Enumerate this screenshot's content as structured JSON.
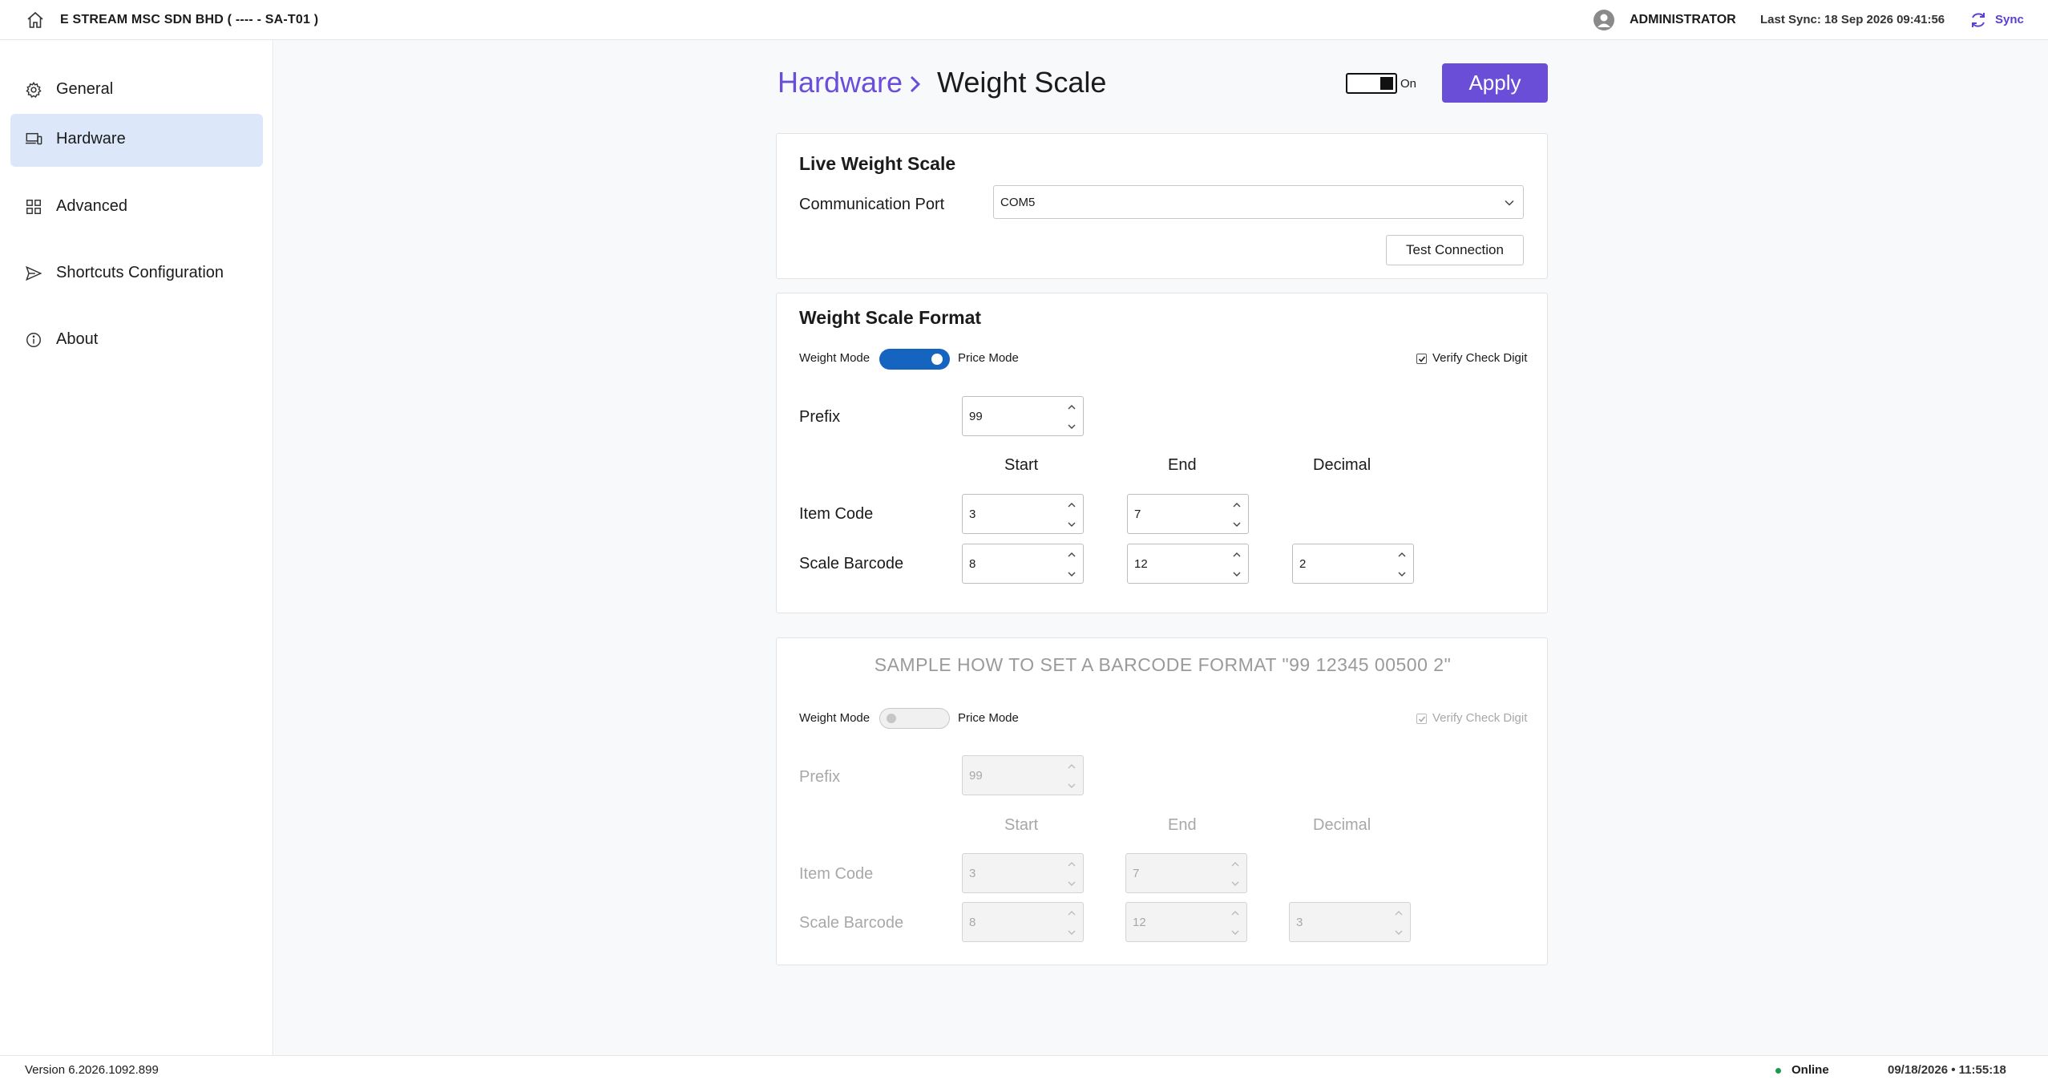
{
  "header": {
    "company": "E STREAM MSC SDN BHD ( ---- - SA-T01 )",
    "user": "ADMINISTRATOR",
    "last_sync": "Last Sync: 18 Sep 2026 09:41:56",
    "sync_label": "Sync"
  },
  "sidebar": {
    "items": [
      {
        "label": "General",
        "icon": "gear-icon"
      },
      {
        "label": "Hardware",
        "icon": "devices-icon",
        "active": true
      },
      {
        "label": "Advanced",
        "icon": "grid-icon"
      },
      {
        "label": "Shortcuts Configuration",
        "icon": "send-icon"
      },
      {
        "label": "About",
        "icon": "info-icon"
      }
    ],
    "version": "Version 6.2026.1092.899"
  },
  "breadcrumb": {
    "parent": "Hardware",
    "current": "Weight Scale"
  },
  "toolbar": {
    "toggle_label": "On",
    "toggle_on": true,
    "apply_label": "Apply"
  },
  "live_scale": {
    "title": "Live Weight Scale",
    "port_label": "Communication Port",
    "port_value": "COM5",
    "test_button": "Test Connection"
  },
  "format": {
    "title": "Weight Scale Format",
    "weight_mode": "Weight Mode",
    "price_mode": "Price Mode",
    "mode_is_price": true,
    "verify_label": "Verify Check Digit",
    "verify_checked": true,
    "prefix_label": "Prefix",
    "prefix": "99",
    "col_start": "Start",
    "col_end": "End",
    "col_decimal": "Decimal",
    "item_code_label": "Item Code",
    "item_code_start": "3",
    "item_code_end": "7",
    "scale_barcode_label": "Scale Barcode",
    "scale_barcode_start": "8",
    "scale_barcode_end": "12",
    "scale_barcode_decimal": "2"
  },
  "sample": {
    "title": "SAMPLE HOW TO SET A BARCODE FORMAT \"99 12345 00500 2\"",
    "weight_mode": "Weight Mode",
    "price_mode": "Price Mode",
    "mode_is_price": false,
    "verify_label": "Verify Check Digit",
    "verify_checked": true,
    "prefix_label": "Prefix",
    "prefix": "99",
    "col_start": "Start",
    "col_end": "End",
    "col_decimal": "Decimal",
    "item_code_label": "Item Code",
    "item_code_start": "3",
    "item_code_end": "7",
    "scale_barcode_label": "Scale Barcode",
    "scale_barcode_start": "8",
    "scale_barcode_end": "12",
    "scale_barcode_decimal": "3"
  },
  "status": {
    "online": "Online",
    "datetime": "09/18/2026  • 11:55:18"
  },
  "colors": {
    "accent": "#6a4ed8",
    "active_nav": "#dce8fa",
    "switch_on": "#1565c0",
    "online": "#1a9d4a"
  }
}
